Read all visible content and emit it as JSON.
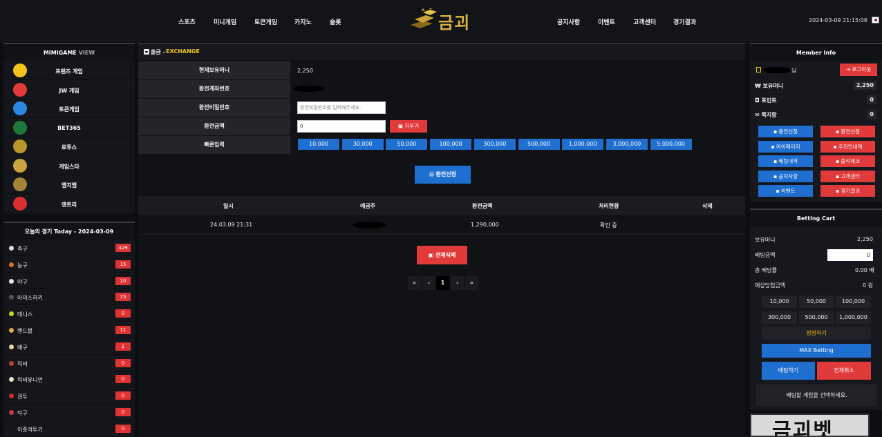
{
  "header": {
    "nav_left": [
      "스포츠",
      "미니게임",
      "토큰게임",
      "카지노",
      "슬롯"
    ],
    "nav_right": [
      "공지사항",
      "이벤트",
      "고객센터",
      "경기결과"
    ],
    "logo_text": "금괴",
    "datetime": "2024-03-09 21:15:06"
  },
  "left": {
    "games_title_a": "MIMIGAME",
    "games_title_b": "VIEW",
    "games": [
      {
        "label": "프렌즈 게임",
        "icon": "friends-game-icon",
        "color": "#f4c21b"
      },
      {
        "label": "JW 게임",
        "icon": "jw-game-icon",
        "color": "#e33b3b"
      },
      {
        "label": "토큰게임",
        "icon": "token-game-icon",
        "color": "#2a8ae0"
      },
      {
        "label": "BET365",
        "icon": "bet365-icon",
        "color": "#1d7a3a"
      },
      {
        "label": "로투스",
        "icon": "lotus-icon",
        "color": "#b89528"
      },
      {
        "label": "게임스타",
        "icon": "gamestar-icon",
        "color": "#caa53b"
      },
      {
        "label": "엠지엠",
        "icon": "mgm-icon",
        "color": "#a5843a"
      },
      {
        "label": "엔트리",
        "icon": "entry-icon",
        "color": "#d8312f"
      }
    ],
    "today_title": "오늘의 경기 Today - 2024-03-09",
    "sports": [
      {
        "name": "축구",
        "count": "429",
        "icon": "soccer-icon",
        "color": "#dcdcdc"
      },
      {
        "name": "농구",
        "count": "15",
        "icon": "basketball-icon",
        "color": "#e46a1d"
      },
      {
        "name": "야구",
        "count": "10",
        "icon": "baseball-icon",
        "color": "#e5e5e5"
      },
      {
        "name": "아이스하키",
        "count": "15",
        "icon": "ice-hockey-icon",
        "color": "#555555"
      },
      {
        "name": "테니스",
        "count": "0",
        "icon": "tennis-icon",
        "color": "#c6d62d"
      },
      {
        "name": "핸드볼",
        "count": "11",
        "icon": "handball-icon",
        "color": "#e3a84a"
      },
      {
        "name": "배구",
        "count": "1",
        "icon": "volleyball-icon",
        "color": "#e7d59a"
      },
      {
        "name": "럭비",
        "count": "0",
        "icon": "rugby-icon",
        "color": "#b8432c"
      },
      {
        "name": "럭비유니언",
        "count": "0",
        "icon": "rugby-union-icon",
        "color": "#e8e0c0"
      },
      {
        "name": "권투",
        "count": "0",
        "icon": "boxing-icon",
        "color": "#d62a2a"
      },
      {
        "name": "탁구",
        "count": "0",
        "icon": "table-tennis-icon",
        "color": "#c23c3c"
      },
      {
        "name": "이종격투기",
        "count": "0",
        "icon": "mma-icon",
        "color": "#15161b"
      }
    ]
  },
  "exchange": {
    "title_a": "출금 -",
    "title_b": "EXCHANGE",
    "current_money_label": "현재보유머니",
    "current_money": "2,250",
    "account_label": "환전계좌번호",
    "password_label": "환전비밀번호",
    "password_placeholder": "환전비밀번호를 입력해주세요.",
    "amount_label": "환전금액",
    "amount_value": "0",
    "clear_label": "지우기",
    "quick_label": "빠른입력",
    "quick": [
      "10,000",
      "30,000",
      "50,000",
      "100,000",
      "300,000",
      "500,000",
      "1,000,000",
      "3,000,000",
      "5,000,000"
    ],
    "submit_label": "환전신청",
    "table_headers": [
      "일시",
      "예금주",
      "환전금액",
      "처리현황",
      "삭제"
    ],
    "rows": [
      {
        "date": "24.03.09 21:31",
        "amount": "1,290,000",
        "status": "확인 중"
      }
    ],
    "delete_all_label": "전체삭제",
    "pager": [
      "«",
      "‹",
      "1",
      "›",
      "»"
    ]
  },
  "member": {
    "title": "Member Info",
    "name_suffix": "님",
    "logout_label": "로그아웃",
    "money_label": "보유머니",
    "money": "2,250",
    "point_label": "포인트",
    "point": "0",
    "msg_label": "쪽지함",
    "msg": "0",
    "buttons": [
      {
        "label": "충전신청",
        "color": "blue",
        "icon": "plus-square-icon"
      },
      {
        "label": "환전신청",
        "color": "red",
        "icon": "minus-square-icon"
      },
      {
        "label": "마이페이지",
        "color": "blue",
        "icon": "user-icon"
      },
      {
        "label": "추천인내역",
        "color": "red",
        "icon": "users-icon"
      },
      {
        "label": "배팅내역",
        "color": "blue",
        "icon": "list-icon"
      },
      {
        "label": "출석체크",
        "color": "red",
        "icon": "calendar-check-icon"
      },
      {
        "label": "공지사항",
        "color": "blue",
        "icon": "megaphone-icon"
      },
      {
        "label": "고객센터",
        "color": "red",
        "icon": "chat-icon"
      },
      {
        "label": "이벤트",
        "color": "blue",
        "icon": "gift-icon"
      },
      {
        "label": "경기결과",
        "color": "red",
        "icon": "history-icon"
      }
    ]
  },
  "cart": {
    "title": "Betting Cart",
    "money_label": "보유머니",
    "money": "2,250",
    "bet_label": "배팅금액",
    "bet_value": "0",
    "odds_label": "총 배당률",
    "odds": "0.00 배",
    "expect_label": "예상당첨금액",
    "expect": "0 원",
    "amounts": [
      "10,000",
      "50,000",
      "100,000",
      "300,000",
      "500,000",
      "1,000,000"
    ],
    "edit_label": "정정하기",
    "max_label": "MAX Betting",
    "bet_btn": "배팅하기",
    "cancel_btn": "전체취소",
    "hint": "배팅할 게임을 선택하세요.",
    "banner_text": "금괴벳"
  },
  "colors": {
    "accent_yellow": "#f2c21a",
    "blue": "#1f6fd1",
    "red": "#e03a3a"
  }
}
